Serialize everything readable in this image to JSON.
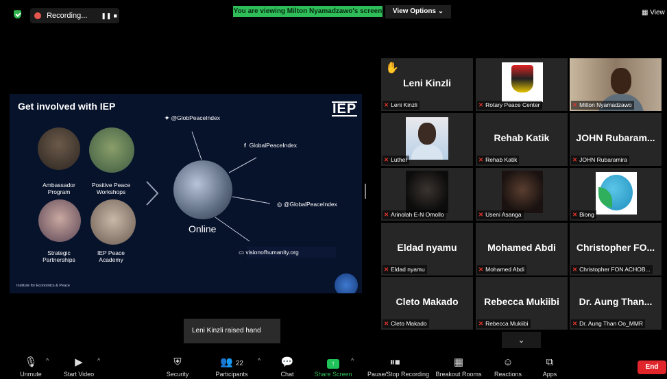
{
  "top_bar": {
    "recording_label": "Recording...",
    "viewing_banner": "You are viewing Milton Nyamadzawo's screen",
    "view_options": "View Options ⌄",
    "view_label": "View"
  },
  "slide": {
    "title": "Get involved with IEP",
    "logo": "IEP",
    "circles": [
      {
        "label": "Ambassador\nProgram"
      },
      {
        "label": "Positive Peace\nWorkshops"
      },
      {
        "label": "Strategic\nPartnerships"
      },
      {
        "label": "IEP Peace\nAcademy"
      }
    ],
    "center_label": "Online",
    "links": {
      "twitter": "@GlobPeaceIndex",
      "facebook": "GlobalPeaceIndex",
      "instagram": "@GlobalPeaceIndex",
      "website": "visionofhumanity.org"
    },
    "footer": "Institute for Economics & Peace"
  },
  "gallery": [
    {
      "display": "Leni Kinzli",
      "label": "Leni Kinzli",
      "hand": true
    },
    {
      "display": "",
      "label": "Rotary Peace Center"
    },
    {
      "display": "",
      "label": "Milton Nyamadzawo"
    },
    {
      "display": "",
      "label": "Luther"
    },
    {
      "display": "Rehab Katik",
      "label": "Rehab Katik"
    },
    {
      "display": "JOHN  Rubaram...",
      "label": "JOHN Rubaramira"
    },
    {
      "display": "",
      "label": "Arinolah E-N Omollo"
    },
    {
      "display": "",
      "label": "Useni Asanga"
    },
    {
      "display": "",
      "label": "Biong"
    },
    {
      "display": "Eldad nyamu",
      "label": "Eldad nyamu"
    },
    {
      "display": "Mohamed Abdi",
      "label": "Mohamed Abdi"
    },
    {
      "display": "Christopher  FO...",
      "label": "Christopher FON ACHOB..."
    },
    {
      "display": "Cleto Makado",
      "label": "Cleto Makado"
    },
    {
      "display": "Rebecca Mukiibi",
      "label": "Rebecca Mukiibi"
    },
    {
      "display": "Dr. Aung Than...",
      "label": "Dr. Aung Than Oo_MMR"
    }
  ],
  "toast": "Leni Kinzli raised hand",
  "toolbar": {
    "unmute": "Unmute",
    "start_video": "Start Video",
    "security": "Security",
    "participants": "Participants",
    "participants_count": "22",
    "chat": "Chat",
    "share_screen": "Share Screen",
    "pause_recording": "Pause/Stop Recording",
    "breakout_rooms": "Breakout Rooms",
    "reactions": "Reactions",
    "apps": "Apps",
    "end": "End"
  },
  "colors": {
    "green_banner": "#2ebd59",
    "end_red": "#e0262b",
    "active_speaker": "#dde033",
    "muted_red": "#e2342b"
  }
}
